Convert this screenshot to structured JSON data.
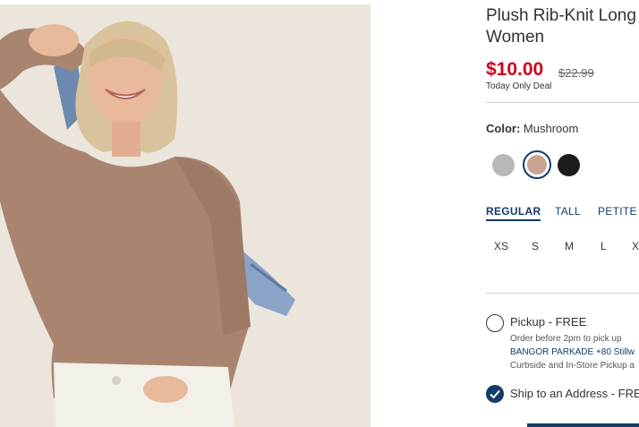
{
  "product": {
    "title_line1": "Plush Rib-Knit Long",
    "title_line2": "Women",
    "price": "$10.00",
    "original_price": "$22.99",
    "deal_text": "Today Only Deal"
  },
  "color": {
    "label": "Color:",
    "selected": "Mushroom",
    "swatches": [
      {
        "name": "Heather Gray",
        "hex": "#b8b8b8"
      },
      {
        "name": "Mushroom",
        "hex": "#c9a493"
      },
      {
        "name": "Black",
        "hex": "#1c1c1c"
      }
    ]
  },
  "fits": [
    {
      "label": "REGULAR",
      "selected": true
    },
    {
      "label": "TALL",
      "selected": false
    },
    {
      "label": "PETITE",
      "selected": false
    }
  ],
  "sizes": [
    "XS",
    "S",
    "M",
    "L",
    "X"
  ],
  "fulfillment": {
    "pickup": {
      "label": "Pickup - FREE",
      "line1": "Order before 2pm to pick up",
      "line2": "BANGOR PARKADE +80 Stillw",
      "line3": "Curbside and In-Store Pickup a"
    },
    "ship": {
      "label": "Ship to an Address - FRE"
    }
  },
  "colors": {
    "accent": "#123c69",
    "sale": "#d0021b"
  }
}
